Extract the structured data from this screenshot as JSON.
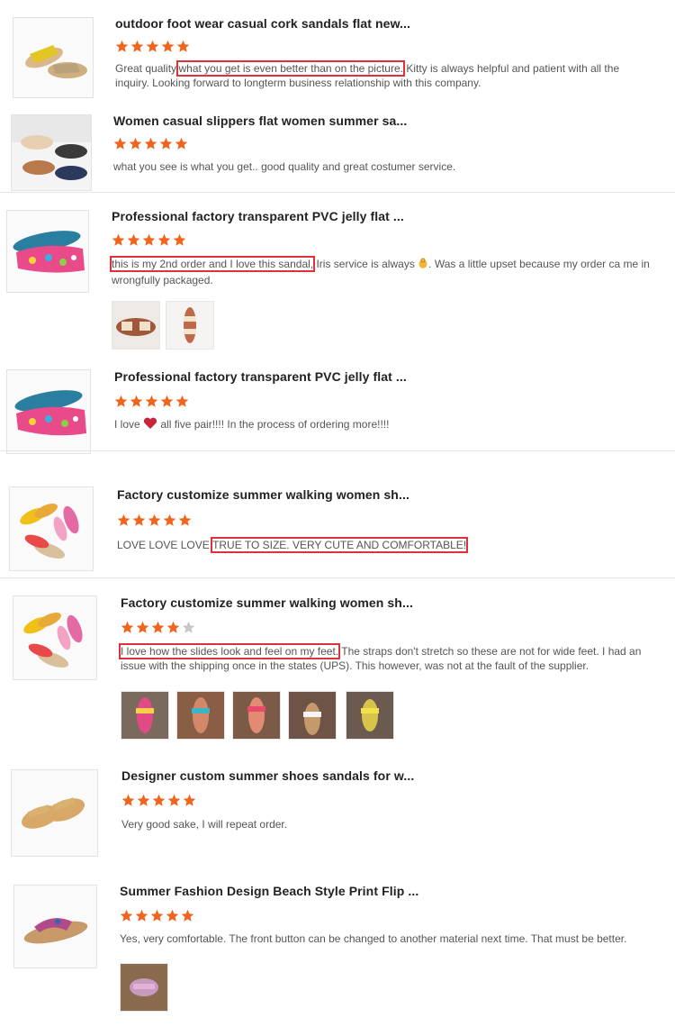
{
  "colors": {
    "star_filled": "#f0641e",
    "star_empty": "#c8c8c8",
    "highlight": "#e0313a"
  },
  "reviews": [
    {
      "title": "outdoor foot wear casual cork sandals flat new...",
      "rating": 5,
      "text_before": "Great quality,",
      "highlight": "what you get is even better than on the picture.",
      "text_after": " Kitty is always helpful and patient with all the inquiry. Looking forward to longterm business relationship with this company."
    },
    {
      "title": "Women casual slippers flat women summer sa...",
      "rating": 5,
      "text": "what you see is what you get.. good quality and great costumer service."
    },
    {
      "title": "Professional factory transparent PVC jelly flat ...",
      "rating": 5,
      "highlight": "this is my 2nd order and I love this sandal,",
      "text_after_a": " Iris service is always ",
      "text_after_b": ". Was a little upset because my order ca me in wrongfully packaged."
    },
    {
      "title": "Professional factory transparent PVC jelly flat ...",
      "rating": 5,
      "text_before": "I love ",
      "text_after": " all five pair!!!! In the process of ordering more!!!!"
    },
    {
      "title": "Factory customize summer walking women sh...",
      "rating": 5,
      "text_before": "LOVE LOVE LOVE.",
      "highlight": "TRUE TO SIZE. VERY CUTE AND COMFORTABLE!"
    },
    {
      "title": "Factory customize summer walking women sh...",
      "rating": 4,
      "highlight": "I love how the slides look and feel on my feet.",
      "text_after": " The straps don't stretch so these are not for wide feet. I had an issue with the shipping once in the states (UPS). This however, was not at the fault of the supplier."
    },
    {
      "title": "Designer custom summer shoes sandals for w...",
      "rating": 5,
      "text": "Very good sake, I will repeat order."
    },
    {
      "title": "Summer Fashion Design Beach Style Print Flip ...",
      "rating": 5,
      "text": "Yes, very comfortable. The front button can be changed to another material next time. That must be better."
    }
  ]
}
